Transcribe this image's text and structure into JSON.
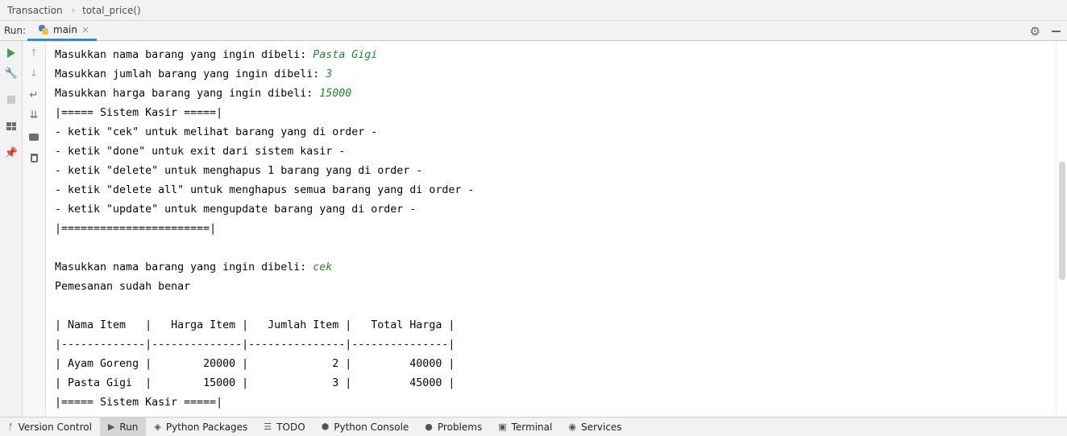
{
  "breadcrumb": {
    "items": [
      "Transaction",
      "total_price()"
    ],
    "separator": "›"
  },
  "runbar": {
    "label": "Run:",
    "tab_label": "main",
    "tab_close": "×"
  },
  "console": {
    "lines": [
      {
        "text": "Masukkan nama barang yang ingin dibeli: ",
        "input": "Pasta Gigi"
      },
      {
        "text": "Masukkan jumlah barang yang ingin dibeli: ",
        "input": "3"
      },
      {
        "text": "Masukkan harga barang yang ingin dibeli: ",
        "input": "15000"
      },
      {
        "text": "|===== Sistem Kasir =====|",
        "input": ""
      },
      {
        "text": "- ketik \"cek\" untuk melihat barang yang di order -",
        "input": ""
      },
      {
        "text": "- ketik \"done\" untuk exit dari sistem kasir -",
        "input": ""
      },
      {
        "text": "- ketik \"delete\" untuk menghapus 1 barang yang di order -",
        "input": ""
      },
      {
        "text": "- ketik \"delete all\" untuk menghapus semua barang yang di order -",
        "input": ""
      },
      {
        "text": "- ketik \"update\" untuk mengupdate barang yang di order -",
        "input": ""
      },
      {
        "text": "|=======================|",
        "input": ""
      },
      {
        "text": "",
        "input": ""
      },
      {
        "text": "Masukkan nama barang yang ingin dibeli: ",
        "input": "cek"
      },
      {
        "text": "Pemesanan sudah benar",
        "input": ""
      },
      {
        "text": "",
        "input": ""
      },
      {
        "text": "| Nama Item   |   Harga Item |   Jumlah Item |   Total Harga |",
        "input": ""
      },
      {
        "text": "|-------------|--------------|---------------|---------------|",
        "input": ""
      },
      {
        "text": "| Ayam Goreng |        20000 |             2 |         40000 |",
        "input": ""
      },
      {
        "text": "| Pasta Gigi  |        15000 |             3 |         45000 |",
        "input": ""
      },
      {
        "text": "|===== Sistem Kasir =====|",
        "input": ""
      }
    ]
  },
  "bottom_tabs": [
    {
      "label": "Version Control",
      "icon": "branch-icon",
      "active": false
    },
    {
      "label": "Run",
      "icon": "play-icon",
      "active": true
    },
    {
      "label": "Python Packages",
      "icon": "layers-icon",
      "active": false
    },
    {
      "label": "TODO",
      "icon": "list-icon",
      "active": false
    },
    {
      "label": "Python Console",
      "icon": "python-icon",
      "active": false
    },
    {
      "label": "Problems",
      "icon": "warning-icon",
      "active": false
    },
    {
      "label": "Terminal",
      "icon": "terminal-icon",
      "active": false
    },
    {
      "label": "Services",
      "icon": "services-icon",
      "active": false
    }
  ],
  "colors": {
    "user_input": "#1f8a2e",
    "run_green": "#3fa34d",
    "tab_underline": "#4083c9"
  }
}
